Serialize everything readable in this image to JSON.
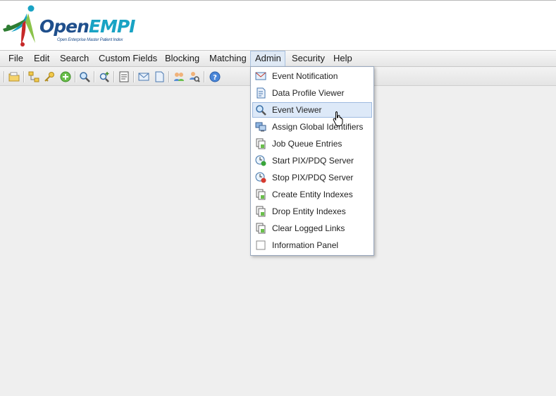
{
  "app": {
    "logo_open": "Open",
    "logo_empi": "EMPI",
    "logo_subtitle": "Open Enterprise Master Patient Index"
  },
  "menubar": {
    "items": [
      "File",
      "Edit",
      "Search",
      "Custom Fields",
      "Blocking",
      "Matching",
      "Admin",
      "Security",
      "Help"
    ],
    "active": "Admin"
  },
  "toolbar": {
    "icons": [
      "open-folder-icon",
      "hierarchy-icon",
      "key-icon",
      "add-icon",
      "search-icon",
      "magnify-add-icon",
      "report-icon",
      "event-icon",
      "document-icon",
      "users-icon",
      "user-search-icon",
      "help-icon"
    ]
  },
  "admin_menu": {
    "items": [
      {
        "label": "Event Notification",
        "icon": "event-notification-icon"
      },
      {
        "label": "Data Profile Viewer",
        "icon": "data-profile-icon"
      },
      {
        "label": "Event Viewer",
        "icon": "magnifier-icon",
        "hover": true
      },
      {
        "label": "Assign Global Identifiers",
        "icon": "computers-icon"
      },
      {
        "label": "Job Queue Entries",
        "icon": "job-queue-icon"
      },
      {
        "label": "Start PIX/PDQ Server",
        "icon": "start-server-icon"
      },
      {
        "label": "Stop PIX/PDQ Server",
        "icon": "stop-server-icon"
      },
      {
        "label": "Create Entity Indexes",
        "icon": "create-index-icon"
      },
      {
        "label": "Drop Entity Indexes",
        "icon": "drop-index-icon"
      },
      {
        "label": "Clear Logged Links",
        "icon": "clear-links-icon"
      },
      {
        "label": "Information Panel",
        "icon": "checkbox-icon"
      }
    ]
  },
  "colors": {
    "brand_dark": "#1f4f8c",
    "brand_light": "#19a3c4",
    "menu_hover": "#dde9f8"
  }
}
